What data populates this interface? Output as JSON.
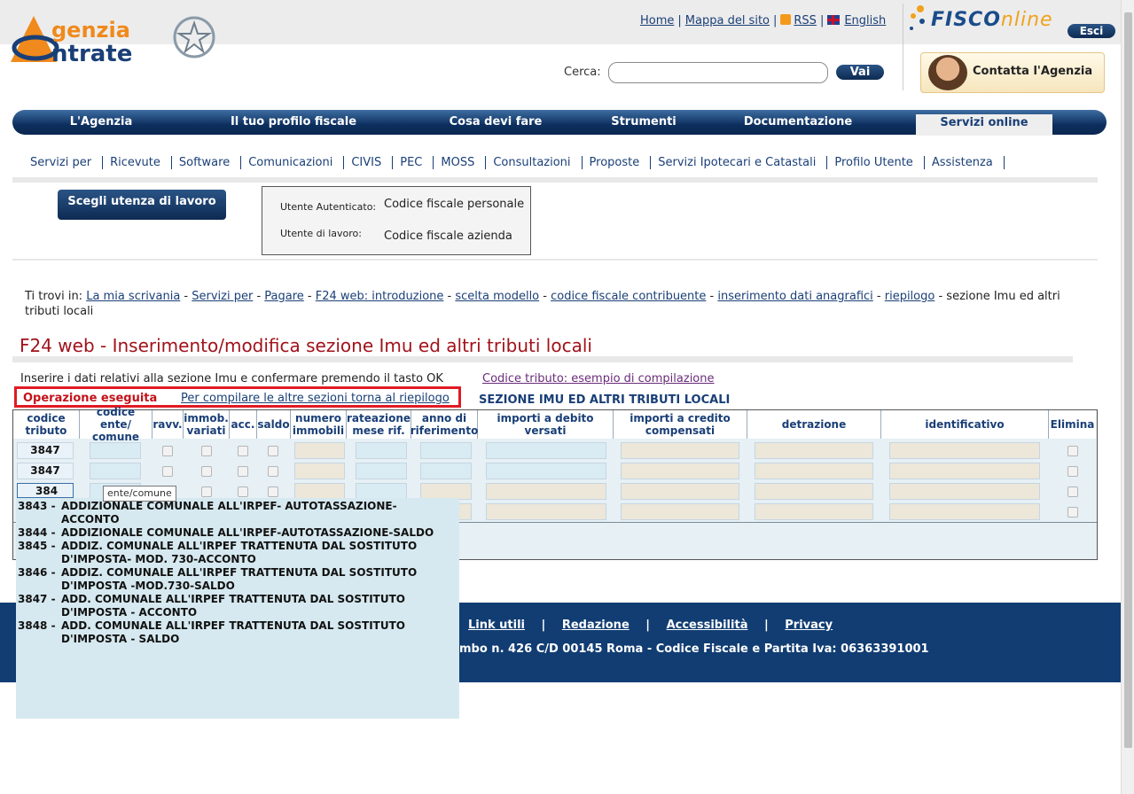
{
  "header": {
    "logo_line1": "genzia",
    "logo_line2": "ntrate",
    "links": [
      "Home",
      "Mappa del sito",
      "RSS",
      "English"
    ],
    "fisco_part1": "FISCO",
    "fisco_part2": "nline",
    "esci_label": "Esci",
    "search_label": "Cerca:",
    "search_value": "",
    "search_button": "Vai",
    "contact_label": "Contatta l'Agenzia"
  },
  "mainnav": [
    "L'Agenzia",
    "Il tuo profilo fiscale",
    "Cosa devi fare",
    "Strumenti",
    "Documentazione",
    "Servizi online"
  ],
  "subnav": [
    "Servizi per",
    "Ricevute",
    "Software",
    "Comunicazioni",
    "CIVIS",
    "PEC",
    "MOSS",
    "Consultazioni",
    "Proposte",
    "Servizi Ipotecari e Catastali",
    "Profilo Utente",
    "Assistenza"
  ],
  "user": {
    "choose_button": "Scegli utenza di lavoro",
    "auth_label": "Utente Autenticato:",
    "auth_value": "Codice fiscale personale",
    "work_label": "Utente di lavoro:",
    "work_value": "Codice fiscale azienda"
  },
  "breadcrumb": {
    "prefix": "Ti trovi in:",
    "links": [
      "La mia scrivania",
      "Servizi per",
      "Pagare",
      "F24 web: introduzione",
      "scelta modello",
      "codice fiscale contribuente",
      "inserimento dati anagrafici",
      "riepilogo"
    ],
    "current": "sezione Imu ed altri tributi locali"
  },
  "page_title": "F24 web - Inserimento/modifica sezione Imu ed altri tributi locali",
  "instructions": "Inserire i dati relativi alla sezione Imu e confermare premendo il tasto OK",
  "example_link": "Codice tributo: esempio di compilazione",
  "status_ok": "Operazione eseguita",
  "back_link": "Per compilare le altre sezioni torna al riepilogo",
  "section_title": "SEZIONE IMU ED ALTRI TRIBUTI LOCALI",
  "table": {
    "headers": [
      "codice tributo",
      "codice ente/ comune",
      "ravv.",
      "immob. variati",
      "acc.",
      "saldo",
      "numero immobili",
      "rateazione mese rif.",
      "anno di riferimento",
      "importi a debito versati",
      "importi a credito compensati",
      "detrazione",
      "identificativo",
      "Elimina"
    ],
    "rows": [
      "3847",
      "3847",
      "384",
      ""
    ]
  },
  "tooltip": "ente/comune",
  "suggestions": [
    {
      "code": "3843 -",
      "desc": "ADDIZIONALE COMUNALE ALL'IRPEF- AUTOTASSAZIONE-",
      "desc2": "ACCONTO"
    },
    {
      "code": "3844 -",
      "desc": "ADDIZIONALE COMUNALE ALL'IRPEF-AUTOTASSAZIONE-SALDO",
      "desc2": ""
    },
    {
      "code": "3845 -",
      "desc": "ADDIZ. COMUNALE ALL'IRPEF TRATTENUTA DAL SOSTITUTO",
      "desc2": "D'IMPOSTA- MOD. 730-ACCONTO"
    },
    {
      "code": "3846 -",
      "desc": "ADDIZ. COMUNALE ALL'IRPEF TRATTENUTA DAL SOSTITUTO",
      "desc2": "D'IMPOSTA -MOD.730-SALDO"
    },
    {
      "code": "3847 -",
      "desc": "ADD. COMUNALE ALL'IRPEF TRATTENUTA DAL SOSTITUTO",
      "desc2": "D'IMPOSTA - ACCONTO"
    },
    {
      "code": "3848 -",
      "desc": "ADD. COMUNALE ALL'IRPEF TRATTENUTA DAL SOSTITUTO",
      "desc2": "D'IMPOSTA - SALDO"
    }
  ],
  "footer": {
    "links": [
      "Link utili",
      "Redazione",
      "Accessibilità",
      "Privacy"
    ],
    "address": "mbo n. 426 C/D 00145 Roma - Codice Fiscale e Partita Iva: 06363391001"
  }
}
